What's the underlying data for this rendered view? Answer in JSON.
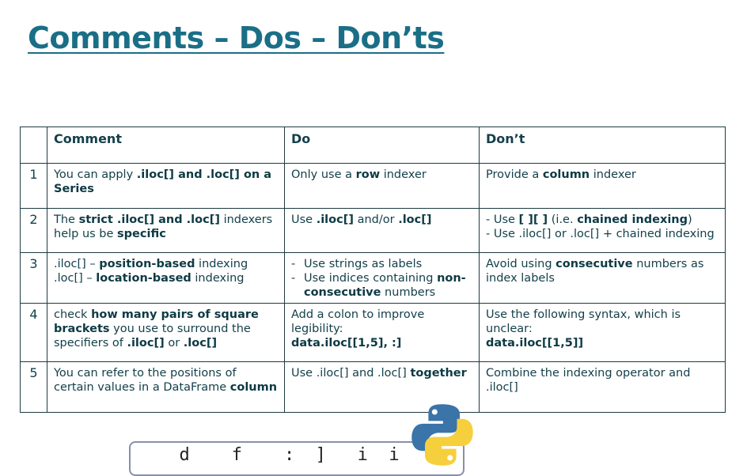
{
  "title": "Comments – Dos – Don’ts",
  "table": {
    "headers": [
      "",
      "Comment",
      "Do",
      "Don’t"
    ],
    "rows": [
      {
        "num": "1",
        "comment": [
          {
            "t": "You can apply "
          },
          {
            "t": ".iloc[] and .loc[] on a Series",
            "b": true
          }
        ],
        "do": [
          {
            "t": "Only use a "
          },
          {
            "t": "row",
            "b": true
          },
          {
            "t": " indexer"
          }
        ],
        "dont": [
          {
            "t": "Provide a "
          },
          {
            "t": "column",
            "b": true
          },
          {
            "t": " indexer"
          }
        ]
      },
      {
        "num": "2",
        "comment": [
          {
            "t": "The "
          },
          {
            "t": "strict .iloc[] and .loc[]",
            "b": true
          },
          {
            "t": " indexers help us be "
          },
          {
            "t": "specific",
            "b": true
          }
        ],
        "do": [
          {
            "t": "Use "
          },
          {
            "t": ".iloc[]",
            "b": true
          },
          {
            "t": " and/or "
          },
          {
            "t": ".loc[]",
            "b": true
          }
        ],
        "dont": [
          {
            "t": "- Use "
          },
          {
            "t": "[ ][ ]",
            "b": true
          },
          {
            "t": " (i.e. "
          },
          {
            "t": "chained indexing",
            "b": true
          },
          {
            "t": ")"
          },
          {
            "br": true
          },
          {
            "t": "- Use .iloc[] or .loc[] + chained indexing"
          }
        ]
      },
      {
        "num": "3",
        "comment": [
          {
            "t": ".iloc[] – "
          },
          {
            "t": "position-based",
            "b": true
          },
          {
            "t": " indexing"
          },
          {
            "br": true
          },
          {
            "t": ".loc[] – "
          },
          {
            "t": "location-based",
            "b": true
          },
          {
            "t": " indexing"
          }
        ],
        "do_list": [
          [
            {
              "t": "Use strings as labels"
            }
          ],
          [
            {
              "t": "Use indices containing "
            },
            {
              "t": "non-consecutive",
              "b": true
            },
            {
              "t": " numbers"
            }
          ]
        ],
        "dont": [
          {
            "t": "Avoid using "
          },
          {
            "t": "consecutive",
            "b": true
          },
          {
            "t": " numbers as index labels"
          }
        ]
      },
      {
        "num": "4",
        "comment": [
          {
            "t": "check "
          },
          {
            "t": "how many pairs of square brackets",
            "b": true
          },
          {
            "t": " you use to surround the specifiers of "
          },
          {
            "t": ".iloc[]",
            "b": true
          },
          {
            "t": " or "
          },
          {
            "t": ".loc[]",
            "b": true
          }
        ],
        "do": [
          {
            "t": "Add a colon to improve legibility:"
          },
          {
            "br": true
          },
          {
            "t": "data.iloc[[1,5], :]",
            "b": true
          }
        ],
        "dont": [
          {
            "t": "Use the following syntax, which is unclear:"
          },
          {
            "br": true
          },
          {
            "t": "data.iloc[[1,5]]",
            "b": true
          }
        ]
      },
      {
        "num": "5",
        "comment": [
          {
            "t": "You can refer to the positions of certain values in a DataFrame "
          },
          {
            "t": "column",
            "b": true
          }
        ],
        "do": [
          {
            "t": "Use .iloc[] and .loc[] "
          },
          {
            "t": "together",
            "b": true
          }
        ],
        "dont": [
          {
            "t": "Combine the indexing operator and .iloc[]"
          }
        ]
      }
    ]
  },
  "bottom_snippet": "  d    f    :  ]   i  i   t",
  "icons": {
    "logo": "python-logo"
  },
  "colors": {
    "title": "#1a6f86",
    "python_blue": "#3a74a8",
    "python_yellow": "#f6cf3c"
  }
}
